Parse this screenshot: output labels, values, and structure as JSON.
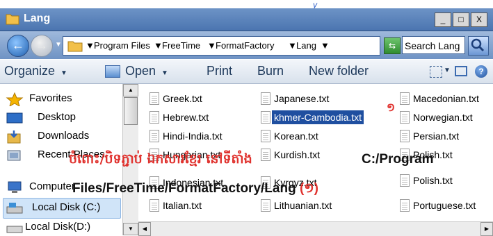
{
  "window": {
    "title": "Lang",
    "top_mark": "y"
  },
  "controls": {
    "minimize": "_",
    "maximize": "□",
    "close": "X"
  },
  "address": {
    "crumbs": [
      "Program Files",
      "FreeTime",
      "FormatFactory",
      "Lang"
    ],
    "search_placeholder": "Search Lang"
  },
  "toolbar": {
    "organize": "Organize",
    "open": "Open",
    "print": "Print",
    "burn": "Burn",
    "new_folder": "New folder"
  },
  "nav": {
    "items": [
      {
        "label": "Favorites",
        "icon": "star-icon"
      },
      {
        "label": "Desktop",
        "icon": "desktop-icon"
      },
      {
        "label": "Downloads",
        "icon": "downloads-icon"
      },
      {
        "label": "Recent Places",
        "icon": "recent-places-icon"
      },
      {
        "label": "Computer",
        "icon": "computer-icon"
      },
      {
        "label": "Local Disk (C:)",
        "icon": "drive-icon",
        "selected": true
      },
      {
        "label": "Local Disk(D:)",
        "icon": "drive-icon"
      }
    ]
  },
  "files": {
    "col1": [
      "Greek.txt",
      "Hebrew.txt",
      "Hindi-India.txt",
      "Hungarian.txt",
      "Indonesian.txt",
      "Italian.txt"
    ],
    "col2": [
      "Japanese.txt",
      "khmer-Cambodia.txt",
      "Korean.txt",
      "Kurdish.txt",
      "Kyrgyz.txt",
      "Lithuanian.txt"
    ],
    "col3": [
      "Macedonian.txt",
      "Norwegian.txt",
      "Persian.txt",
      "Polish.txt",
      "Polish.txt",
      "Portuguese.txt"
    ],
    "selected": "khmer-Cambodia.txt"
  },
  "annotation": {
    "khmer_text": "ចំពោះ/បិទភ្ជាប់ ឯកសារខ្មែរ នៅទីតាំង",
    "path_line1": "C:/Program",
    "path_line2": "Files/FreeTime/FormatFactory/Lang",
    "step_number": "(១)",
    "marker": "១"
  },
  "colors": {
    "annotation_red": "#e0322e",
    "selection_blue": "#1f4fa0",
    "titlebar_blue": "#4b75b0"
  }
}
